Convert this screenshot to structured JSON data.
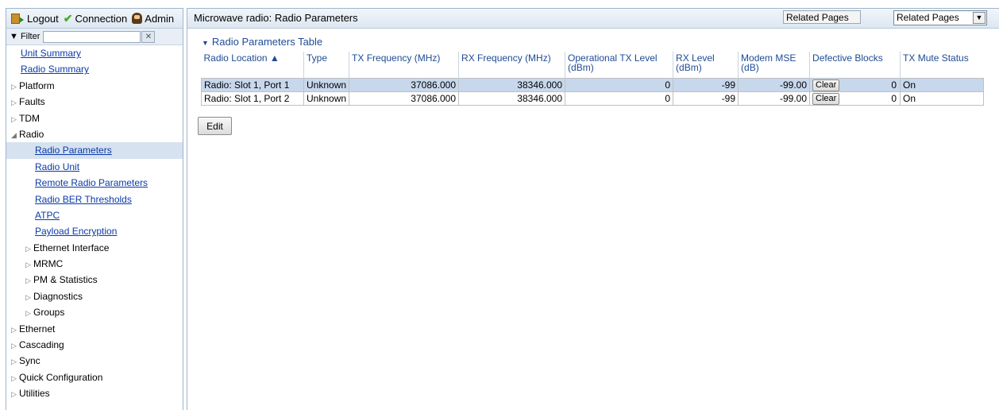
{
  "topbar": {
    "logout": "Logout",
    "connection": "Connection",
    "admin": "Admin"
  },
  "filter": {
    "label": "▼ Filter",
    "value": "",
    "clear": "✕"
  },
  "tree": [
    {
      "label": "Unit Summary",
      "kind": "link",
      "level": 0
    },
    {
      "label": "Radio Summary",
      "kind": "link",
      "level": 0
    },
    {
      "label": "Platform",
      "kind": "collapsed",
      "level": 0
    },
    {
      "label": "Faults",
      "kind": "collapsed",
      "level": 0
    },
    {
      "label": "TDM",
      "kind": "collapsed",
      "level": 0
    },
    {
      "label": "Radio",
      "kind": "expanded",
      "level": 0
    },
    {
      "label": "Radio Parameters",
      "kind": "link",
      "level": 1,
      "selected": true
    },
    {
      "label": "Radio Unit",
      "kind": "link",
      "level": 1
    },
    {
      "label": "Remote Radio Parameters",
      "kind": "link",
      "level": 1
    },
    {
      "label": "Radio BER Thresholds",
      "kind": "link",
      "level": 1
    },
    {
      "label": "ATPC",
      "kind": "link",
      "level": 1
    },
    {
      "label": "Payload Encryption",
      "kind": "link",
      "level": 1
    },
    {
      "label": "Ethernet Interface",
      "kind": "collapsed",
      "level": 1
    },
    {
      "label": "MRMC",
      "kind": "collapsed",
      "level": 1
    },
    {
      "label": "PM & Statistics",
      "kind": "collapsed",
      "level": 1
    },
    {
      "label": "Diagnostics",
      "kind": "collapsed",
      "level": 1
    },
    {
      "label": "Groups",
      "kind": "collapsed",
      "level": 1
    },
    {
      "label": "Ethernet",
      "kind": "collapsed",
      "level": 0
    },
    {
      "label": "Cascading",
      "kind": "collapsed",
      "level": 0
    },
    {
      "label": "Sync",
      "kind": "collapsed",
      "level": 0
    },
    {
      "label": "Quick Configuration",
      "kind": "collapsed",
      "level": 0
    },
    {
      "label": "Utilities",
      "kind": "collapsed",
      "level": 0
    }
  ],
  "header": {
    "title": "Microwave radio: Radio Parameters",
    "related_box": "Related Pages",
    "related_select": "Related Pages"
  },
  "table": {
    "title": "Radio Parameters Table",
    "columns": [
      "Radio Location ▲",
      "Type",
      "TX Frequency (MHz)",
      "RX Frequency (MHz)",
      "Operational TX Level (dBm)",
      "RX Level (dBm)",
      "Modem MSE (dB)",
      "Defective Blocks",
      "TX Mute Status"
    ],
    "rows": [
      {
        "location": "Radio: Slot 1, Port 1",
        "type": "Unknown",
        "tx_freq": "37086.000",
        "rx_freq": "38346.000",
        "tx_level": "0",
        "rx_level": "-99",
        "mse": "-99.00",
        "clear": "Clear",
        "defective": "0",
        "mute": "On"
      },
      {
        "location": "Radio: Slot 1, Port 2",
        "type": "Unknown",
        "tx_freq": "37086.000",
        "rx_freq": "38346.000",
        "tx_level": "0",
        "rx_level": "-99",
        "mse": "-99.00",
        "clear": "Clear",
        "defective": "0",
        "mute": "On"
      }
    ]
  },
  "edit_label": "Edit"
}
